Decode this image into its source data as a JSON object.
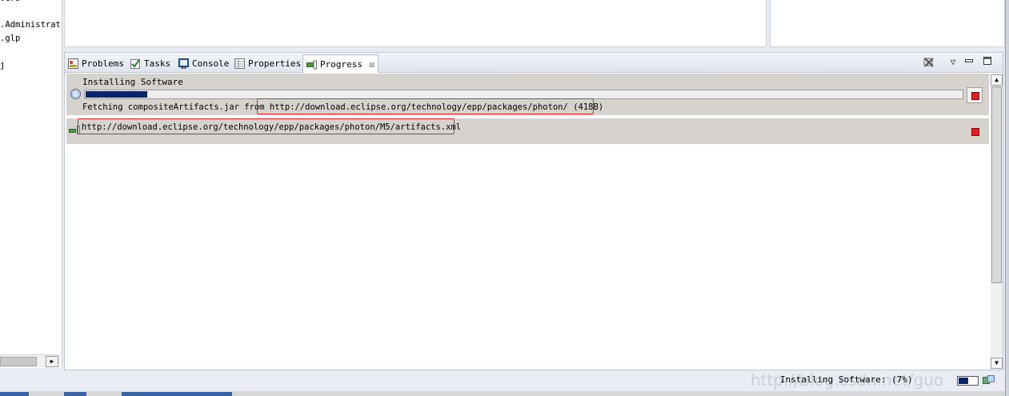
{
  "left_tree": {
    "lines": [
      "vcrs",
      ".Administrat",
      ".glp",
      "j"
    ]
  },
  "tabs": [
    {
      "label": "Problems",
      "icon": "problems-icon",
      "active": false
    },
    {
      "label": "Tasks",
      "icon": "tasks-icon",
      "active": false
    },
    {
      "label": "Console",
      "icon": "console-icon",
      "active": false
    },
    {
      "label": "Properties",
      "icon": "properties-icon",
      "active": false
    },
    {
      "label": "Progress",
      "icon": "progress-icon",
      "active": true
    }
  ],
  "view_toolbar": {
    "remove_all_icon": "remove-all-finished-icon",
    "menu_icon": "view-menu-icon",
    "minimize_icon": "minimize-icon",
    "maximize_icon": "maximize-icon"
  },
  "jobs": [
    {
      "name": "Installing Software",
      "progress": 0.07,
      "detail_prefix": "Fetching compositeArtifacts.jar from",
      "detail_url": "http://download.eclipse.org/technology/epp/packages/photon/ (418B)"
    },
    {
      "url": "http://download.eclipse.org/technology/epp/packages/photon/M5/artifacts.xml"
    }
  ],
  "status": {
    "text": "Installing Software: (7%)",
    "progress": 0.07,
    "watermark": "http://blog.csdn.net/guo"
  },
  "colors": {
    "highlight_box": "#e0262b",
    "progress_fill": "#0a246a",
    "job_row_bg": "#d6d3ce"
  }
}
